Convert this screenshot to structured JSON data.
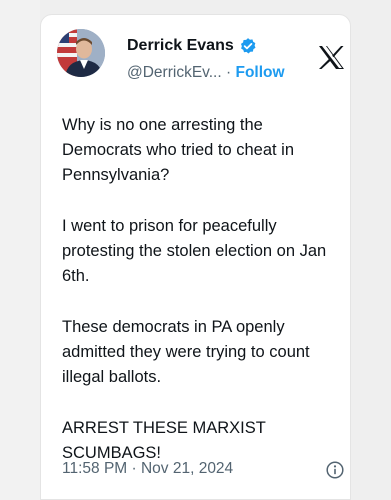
{
  "tweet": {
    "author_name": "Derrick Evans",
    "handle": "@DerrickEv...",
    "separator": "·",
    "follow_label": "Follow",
    "paragraphs": [
      "Why is no one arresting the Democrats who tried to cheat in Pennsylvania?",
      "I went to prison for peacefully protesting the stolen election on Jan 6th.",
      "These democrats in PA openly admitted they were trying to count illegal ballots.",
      "ARREST THESE MARXIST SCUMBAGS!"
    ],
    "timestamp": "11:58 PM · Nov 21, 2024",
    "icons": {
      "verified": "verified-badge-icon",
      "brand": "x-logo-icon",
      "info": "info-icon"
    },
    "colors": {
      "accent": "#1d9bf0",
      "text": "#0f1419",
      "muted": "#536471"
    }
  }
}
